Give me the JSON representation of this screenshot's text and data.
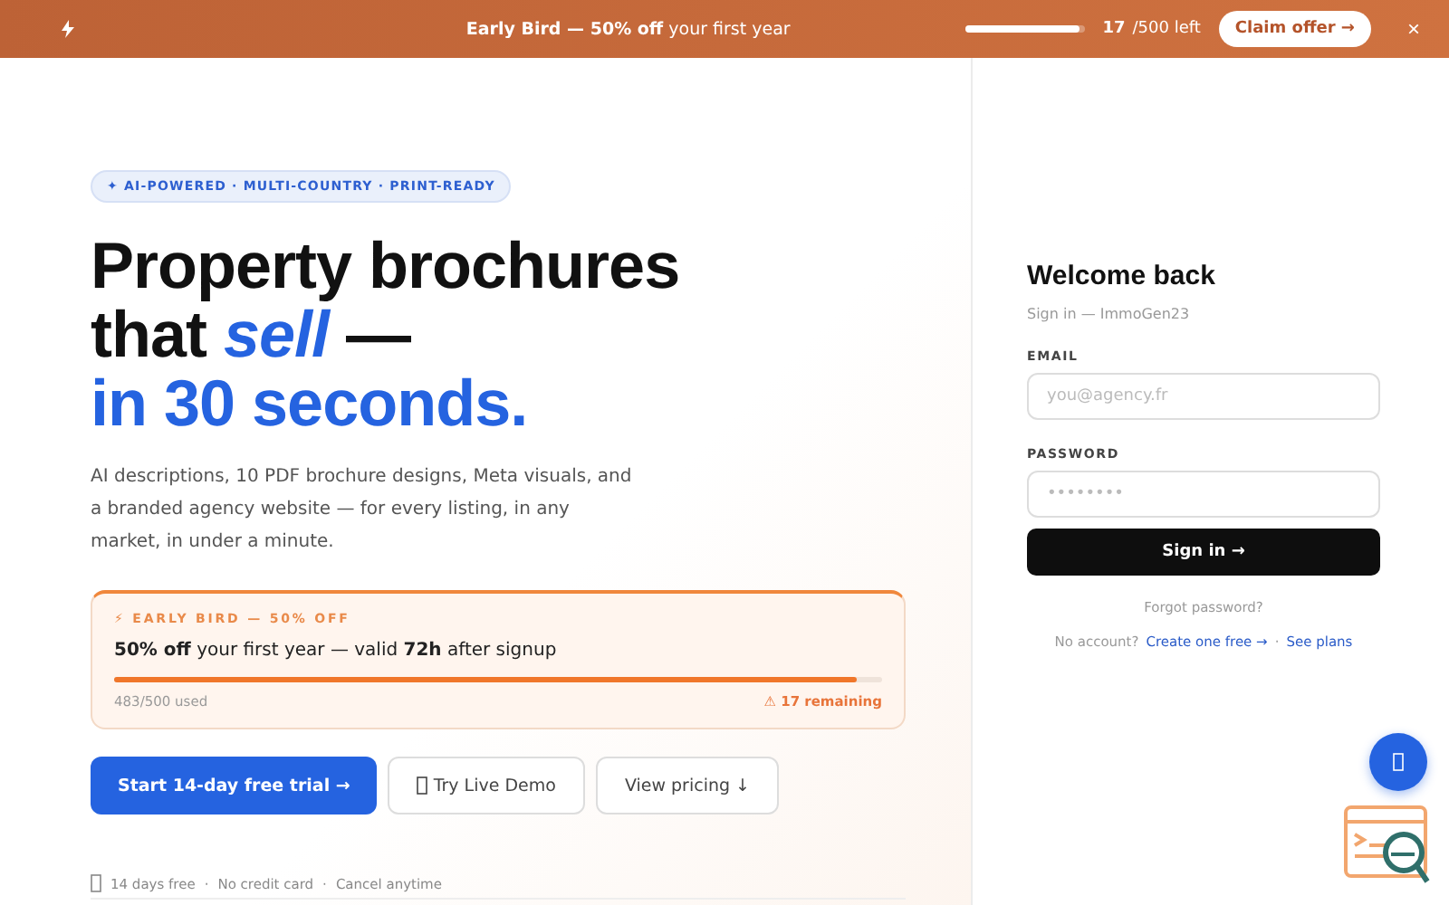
{
  "banner": {
    "message": "**Early Bird — 50% off** your first year",
    "level": 0.966,
    "count": "17",
    "count_suffix": "/500 left",
    "button": "Claim offer →",
    "close": "×"
  },
  "hero": {
    "badge": "✦ AI-POWERED · MULTI-COUNTRY · PRINT-READY",
    "headline_1": "Property brochures",
    "headline_2a": "that ",
    "headline_2b": "sell",
    "headline_2c": " —",
    "headline_3": "in 30 seconds.",
    "description": "AI descriptions, 10 PDF brochure designs, Meta visuals, and a branded agency website — for every listing, in any market, in under a minute."
  },
  "offer": {
    "label": "⚡ EARLY BIRD — 50% OFF",
    "text": "**50% off** your first year — valid **72h** after signup",
    "level": 0.966,
    "used": "483/500 used",
    "remaining": "⚠ 17 remaining"
  },
  "buttons": [
    {
      "kind": "primary",
      "label": "Start 14-day free trial →",
      "icon": false
    },
    {
      "kind": "secondary",
      "label": "Try Live Demo",
      "icon": true
    },
    {
      "kind": "secondary",
      "label": "View pricing ↓",
      "icon": false
    }
  ],
  "perks": [
    "14 days free",
    "·",
    "No credit card",
    "·",
    "Cancel anytime"
  ],
  "login": {
    "title": "Welcome back",
    "subtitle": "Sign in — ImmoGen23",
    "fields": [
      {
        "label": "EMAIL",
        "placeholder": "you@agency.fr"
      },
      {
        "label": "PASSWORD",
        "placeholder": "••••••••"
      }
    ],
    "submit": "Sign in →",
    "forgot": "Forgot password?",
    "no_account": "No account?",
    "create": "Create one free →",
    "separator": "·",
    "plans": "See plans"
  }
}
